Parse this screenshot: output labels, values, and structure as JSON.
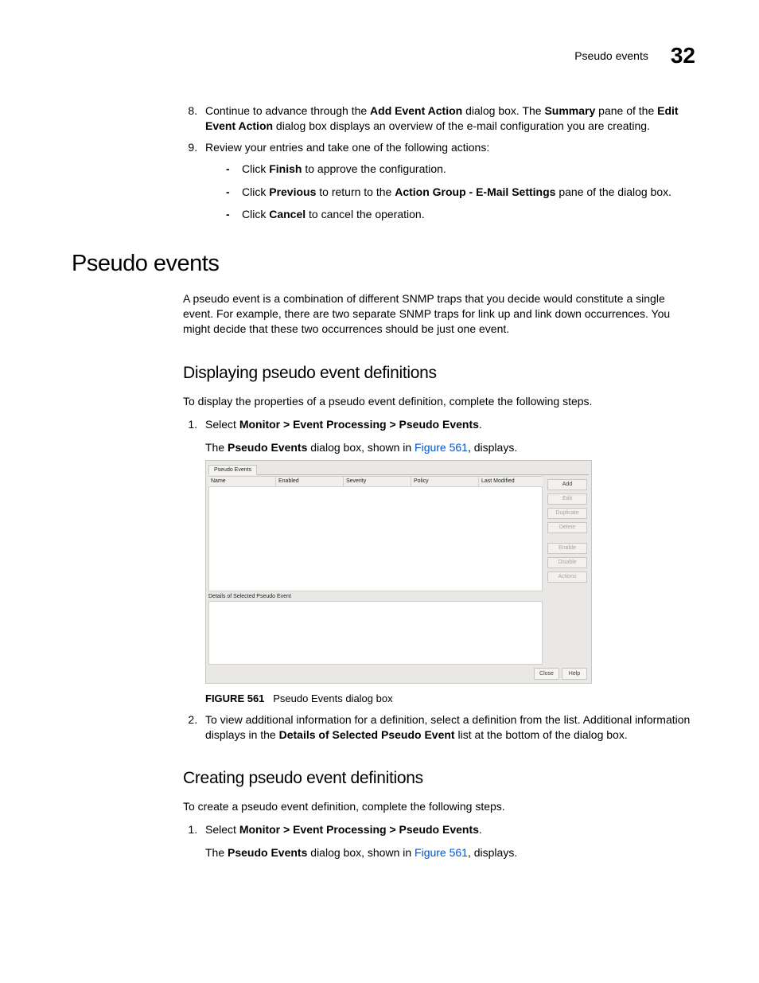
{
  "header": {
    "label": "Pseudo events",
    "chapterNumber": "32"
  },
  "steps_top": {
    "s8": {
      "num": "8.",
      "pre": "Continue to advance through the ",
      "b1": "Add Event Action",
      "mid1": " dialog box. The ",
      "b2": "Summary",
      "mid2": " pane of the ",
      "b3": "Edit Event Action",
      "post": " dialog box displays an overview of the e-mail configuration you are creating."
    },
    "s9": {
      "text": "Review your entries and take one of the following actions:",
      "d1": {
        "pre": "Click ",
        "b": "Finish",
        "post": " to approve the configuration."
      },
      "d2": {
        "pre": "Click ",
        "b1": "Previous",
        "mid": " to return to the ",
        "b2": "Action Group - E-Mail Settings",
        "post": " pane of the dialog box."
      },
      "d3": {
        "pre": "Click ",
        "b": "Cancel",
        "post": " to cancel the operation."
      }
    }
  },
  "section": {
    "title": "Pseudo events",
    "intro": "A pseudo event is a combination of different SNMP traps that you decide would constitute a single event. For example, there are two separate SNMP traps for link up and link down occurrences. You might decide that these two occurrences should be just one event."
  },
  "displaying": {
    "title": "Displaying pseudo event definitions",
    "intro": "To display the properties of a pseudo event definition, complete the following steps.",
    "s1": {
      "pre": "Select ",
      "b": "Monitor > Event Processing > Pseudo Events",
      "post": "."
    },
    "s1_sub": {
      "pre": "The ",
      "b": "Pseudo Events",
      "mid": " dialog box, shown in ",
      "link": "Figure 561",
      "post": ", displays."
    },
    "s2": {
      "pre": "To view additional information for a definition, select a definition from the list. Additional information displays in the ",
      "b": "Details of Selected Pseudo Event",
      "post": " list at the bottom of the dialog box."
    }
  },
  "dialog": {
    "tab": "Pseudo Events",
    "columns": {
      "c0": "Name",
      "c1": "Enabled",
      "c2": "Severity",
      "c3": "Policy",
      "c4": "Last Modified"
    },
    "buttons": {
      "add": "Add",
      "edit": "Edit",
      "duplicate": "Duplicate",
      "delete": "Delete",
      "enable": "Enable",
      "disable": "Disable",
      "actions": "Actions"
    },
    "details_label": "Details of Selected Pseudo Event",
    "footer": {
      "close": "Close",
      "help": "Help"
    }
  },
  "figure": {
    "num": "FIGURE 561",
    "caption": "Pseudo Events dialog box"
  },
  "creating": {
    "title": "Creating pseudo event definitions",
    "intro": "To create a pseudo event definition, complete the following steps.",
    "s1": {
      "pre": "Select ",
      "b": "Monitor > Event Processing > Pseudo Events",
      "post": "."
    },
    "s1_sub": {
      "pre": "The ",
      "b": "Pseudo Events",
      "mid": " dialog box, shown in ",
      "link": "Figure 561",
      "post": ", displays."
    }
  }
}
